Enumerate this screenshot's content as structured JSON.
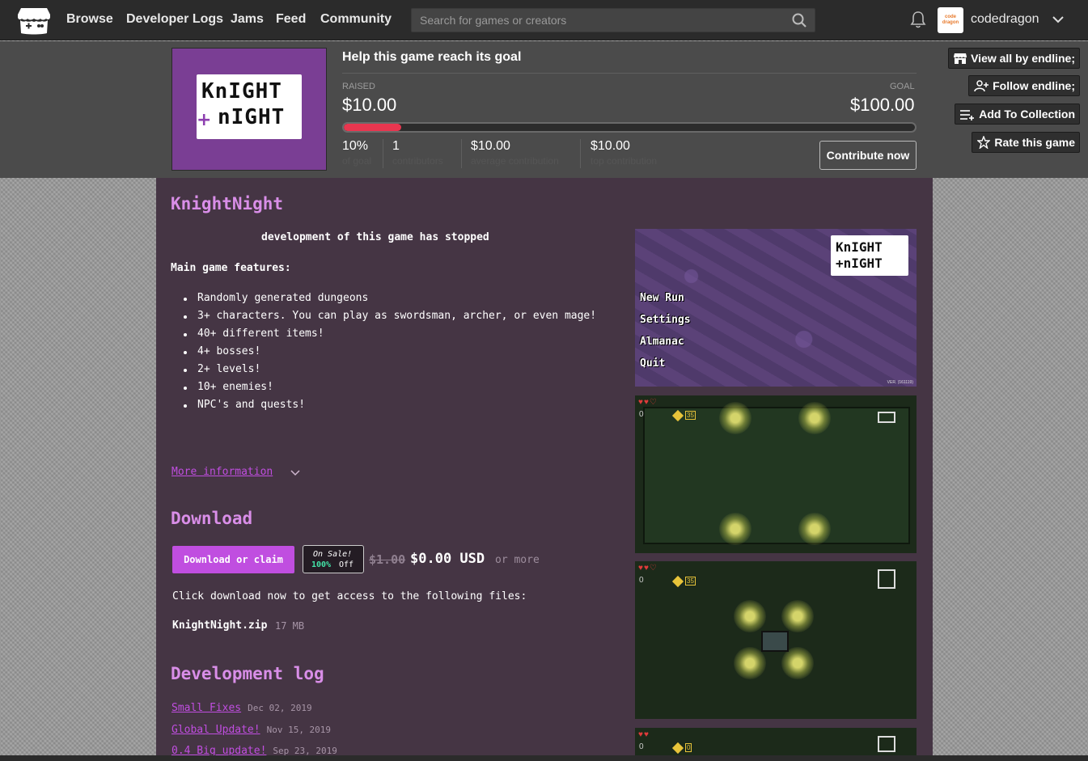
{
  "nav": {
    "links": [
      "Browse",
      "Developer Logs",
      "Jams",
      "Feed",
      "Community"
    ],
    "search_placeholder": "Search for games or creators",
    "username": "codedragon",
    "avatar_text": "code dragon"
  },
  "fund": {
    "title": "Help this game reach its goal",
    "raised_label": "RAISED",
    "raised": "$10.00",
    "goal_label": "GOAL",
    "goal": "$100.00",
    "progress_fraction": 0.1,
    "stats": [
      {
        "value": "10%",
        "label": "of goal"
      },
      {
        "value": "1",
        "label": "contributors"
      },
      {
        "value": "$10.00",
        "label": "average contribution"
      },
      {
        "value": "$10.00",
        "label": "top contribution"
      }
    ],
    "contribute_label": "Contribute now"
  },
  "side_actions": {
    "view_all": "View all by endline;",
    "follow": "Follow endline;",
    "collection": "Add To Collection",
    "rate": "Rate this game"
  },
  "cover": {
    "line1": "KnIGHT",
    "line2": "nIGHT",
    "plus": "+"
  },
  "game": {
    "title": "KnightNight",
    "stopped": "development of this game has stopped",
    "features_heading": "Main game features:",
    "features": [
      "Randomly generated dungeons",
      "3+ characters. You can play as swordsman, archer, or even mage!",
      "40+ different items!",
      "4+ bosses!",
      "2+ levels!",
      "10+ enemies!",
      "NPC's and quests!"
    ],
    "more_info": "More information"
  },
  "download": {
    "heading": "Download",
    "button": "Download or claim",
    "sale_line1": "On Sale!",
    "sale_pct": "100%",
    "sale_off": "Off",
    "old_price": "$1.00",
    "new_price": "$0.00 USD",
    "or_more": "or more",
    "instructions": "Click download now to get access to the following files:",
    "file_name": "KnightNight.zip",
    "file_size": "17 MB"
  },
  "devlog": {
    "heading": "Development log",
    "entries": [
      {
        "title": "Small Fixes",
        "date": "Dec 02, 2019"
      },
      {
        "title": "Global Update!",
        "date": "Nov 15, 2019"
      },
      {
        "title": "0.4 Big update!",
        "date": "Sep 23, 2019"
      }
    ]
  },
  "screenshot_menu": {
    "logo_line1": "KnIGHT",
    "logo_line2": "+nIGHT",
    "items": [
      "New Run",
      "Settings",
      "Almanac",
      "Quit"
    ],
    "version": "VER. (161119)"
  },
  "hud": {
    "hearts_full": "♥♥♡",
    "hearts_two": "♥♥",
    "gems": "35",
    "keys": "0",
    "gems_zero": "0"
  },
  "colors": {
    "nav_bg": "#2b2b2b",
    "banner_bg": "#4b4b4b",
    "main_bg": "#453544",
    "accent_purple": "#c04ee0",
    "title_pink": "#d98ee8",
    "progress_red": "#e8364f",
    "sale_green": "#43e3a7"
  }
}
